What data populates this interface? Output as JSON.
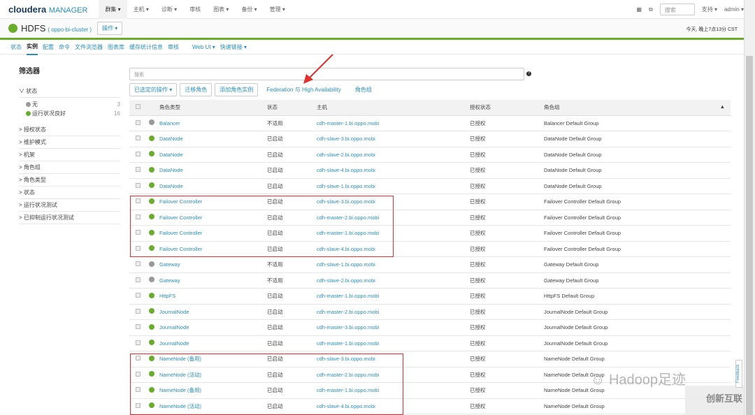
{
  "topnav": {
    "logo_brand": "cloudera",
    "logo_product": "MANAGER",
    "items": [
      "群集 ▾",
      "主机 ▾",
      "诊断 ▾",
      "审核",
      "图表 ▾",
      "备份 ▾",
      "管理 ▾"
    ],
    "search_placeholder": "搜索",
    "support": "支持 ▾",
    "user": "admin ▾"
  },
  "header": {
    "service": "HDFS",
    "cluster": "( oppo-bi-cluster )",
    "actions": "操作 ▾",
    "time": "今天, 晚上7点13分 CST"
  },
  "tabs": [
    "状态",
    "实例",
    "配置",
    "命令",
    "文件浏览器",
    "图表库",
    "缓存统计信息",
    "审核",
    "Web UI ▾",
    "快速链接 ▾"
  ],
  "sidebar": {
    "title": "筛选器",
    "status_group": "∨ 状态",
    "status_items": [
      {
        "label": "无",
        "count": "3",
        "color": "#999999"
      },
      {
        "label": "运行状况良好",
        "count": "16",
        "color": "#6aad2c"
      }
    ],
    "groups": [
      "> 授权状态",
      "> 维护模式",
      "> 机架",
      "> 角色组",
      "> 角色类型",
      "> 状态",
      "> 运行状况测试",
      "> 已抑制运行状况测试"
    ]
  },
  "toolbar": {
    "search_placeholder": "搜索",
    "selected_actions": "已选定的操作 ▾",
    "migrate": "迁移角色",
    "add_instance": "添加角色实例",
    "federation": "Federation 与 High Availability",
    "role_groups": "角色组",
    "help": "?"
  },
  "table": {
    "headers": [
      "角色类型",
      "状态",
      "主机",
      "授权状态",
      "角色组"
    ],
    "rows": [
      [
        "Balancer",
        "不适用",
        "cdh-master-1.bi.oppo.mobi",
        "已授权",
        "Balancer Default Group",
        "gray"
      ],
      [
        "DataNode",
        "已启动",
        "cdh-slave-3.bi.oppo.mobi",
        "已授权",
        "DataNode Default Group",
        "green"
      ],
      [
        "DataNode",
        "已启动",
        "cdh-slave-2.bi.oppo.mobi",
        "已授权",
        "DataNode Default Group",
        "green"
      ],
      [
        "DataNode",
        "已启动",
        "cdh-slave-4.bi.oppo.mobi",
        "已授权",
        "DataNode Default Group",
        "green"
      ],
      [
        "DataNode",
        "已启动",
        "cdh-slave-1.bi.oppo.mobi",
        "已授权",
        "DataNode Default Group",
        "green"
      ],
      [
        "Failover Controller",
        "已启动",
        "cdh-slave-3.bi.oppo.mobi",
        "已授权",
        "Failover Controller Default Group",
        "green"
      ],
      [
        "Failover Controller",
        "已启动",
        "cdh-master-2.bi.oppo.mobi",
        "已授权",
        "Failover Controller Default Group",
        "green"
      ],
      [
        "Failover Controller",
        "已启动",
        "cdh-master-1.bi.oppo.mobi",
        "已授权",
        "Failover Controller Default Group",
        "green"
      ],
      [
        "Failover Controller",
        "已启动",
        "cdh-slave-4.bi.oppo.mobi",
        "已授权",
        "Failover Controller Default Group",
        "green"
      ],
      [
        "Gateway",
        "不适用",
        "cdh-slave-1.bi.oppo.mobi",
        "已授权",
        "Gateway Default Group",
        "gray"
      ],
      [
        "Gateway",
        "不适用",
        "cdh-slave-2.bi.oppo.mobi",
        "已授权",
        "Gateway Default Group",
        "gray"
      ],
      [
        "HttpFS",
        "已启动",
        "cdh-master-1.bi.oppo.mobi",
        "已授权",
        "HttpFS Default Group",
        "green"
      ],
      [
        "JournalNode",
        "已启动",
        "cdh-master-2.bi.oppo.mobi",
        "已授权",
        "JournalNode Default Group",
        "green"
      ],
      [
        "JournalNode",
        "已启动",
        "cdh-master-3.bi.oppo.mobi",
        "已授权",
        "JournalNode Default Group",
        "green"
      ],
      [
        "JournalNode",
        "已启动",
        "cdh-master-1.bi.oppo.mobi",
        "已授权",
        "JournalNode Default Group",
        "green"
      ],
      [
        "NameNode (备用)",
        "已启动",
        "cdh-slave-3.bi.oppo.mobi",
        "已授权",
        "NameNode Default Group",
        "green"
      ],
      [
        "NameNode (活动)",
        "已启动",
        "cdh-master-2.bi.oppo.mobi",
        "已授权",
        "NameNode Default Group",
        "green"
      ],
      [
        "NameNode (备用)",
        "已启动",
        "cdh-master-1.bi.oppo.mobi",
        "已授权",
        "NameNode Default Group",
        "green"
      ],
      [
        "NameNode (活动)",
        "已启动",
        "cdh-slave-4.bi.oppo.mobi",
        "已授权",
        "NameNode Default Group",
        "green"
      ]
    ]
  },
  "colors": {
    "green": "#6aad2c",
    "gray": "#999999",
    "link": "#2a8fbd",
    "highlight": "#e03030"
  },
  "feedback": "Feedback",
  "watermarks": [
    "Hadoop足迹",
    "创新互联"
  ]
}
